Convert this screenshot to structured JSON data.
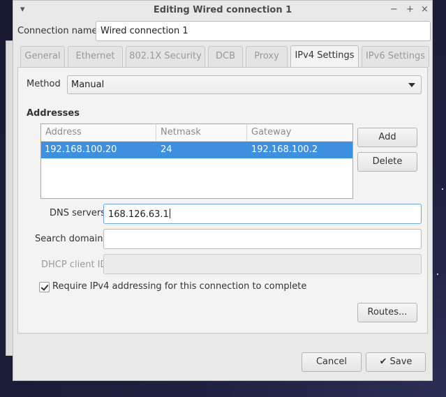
{
  "window": {
    "title": "Editing Wired connection 1",
    "controls": {
      "menu": "▾",
      "minimize": "−",
      "maximize": "+",
      "close": "×"
    }
  },
  "connection_name": {
    "label": "Connection name",
    "value": "Wired connection 1"
  },
  "tabs": [
    {
      "label": "General",
      "active": false
    },
    {
      "label": "Ethernet",
      "active": false
    },
    {
      "label": "802.1X Security",
      "active": false
    },
    {
      "label": "DCB",
      "active": false
    },
    {
      "label": "Proxy",
      "active": false
    },
    {
      "label": "IPv4 Settings",
      "active": true
    },
    {
      "label": "IPv6 Settings",
      "active": false
    }
  ],
  "ipv4": {
    "method": {
      "label": "Method",
      "value": "Manual"
    },
    "addresses": {
      "heading": "Addresses",
      "columns": [
        "Address",
        "Netmask",
        "Gateway"
      ],
      "rows": [
        {
          "address": "192.168.100.20",
          "netmask": "24",
          "gateway": "192.168.100.2"
        }
      ],
      "add_label": "Add",
      "delete_label": "Delete"
    },
    "dns": {
      "label": "DNS servers",
      "value": "168.126.63.1"
    },
    "search_domains": {
      "label": "Search domains",
      "value": ""
    },
    "dhcp_client_id": {
      "label": "DHCP client ID",
      "value": ""
    },
    "require_ipv4": {
      "label": "Require IPv4 addressing for this connection to complete",
      "checked": true
    },
    "routes_label": "Routes..."
  },
  "footer": {
    "cancel_label": "Cancel",
    "save_label": "Save",
    "save_icon": "checkmark-icon"
  }
}
